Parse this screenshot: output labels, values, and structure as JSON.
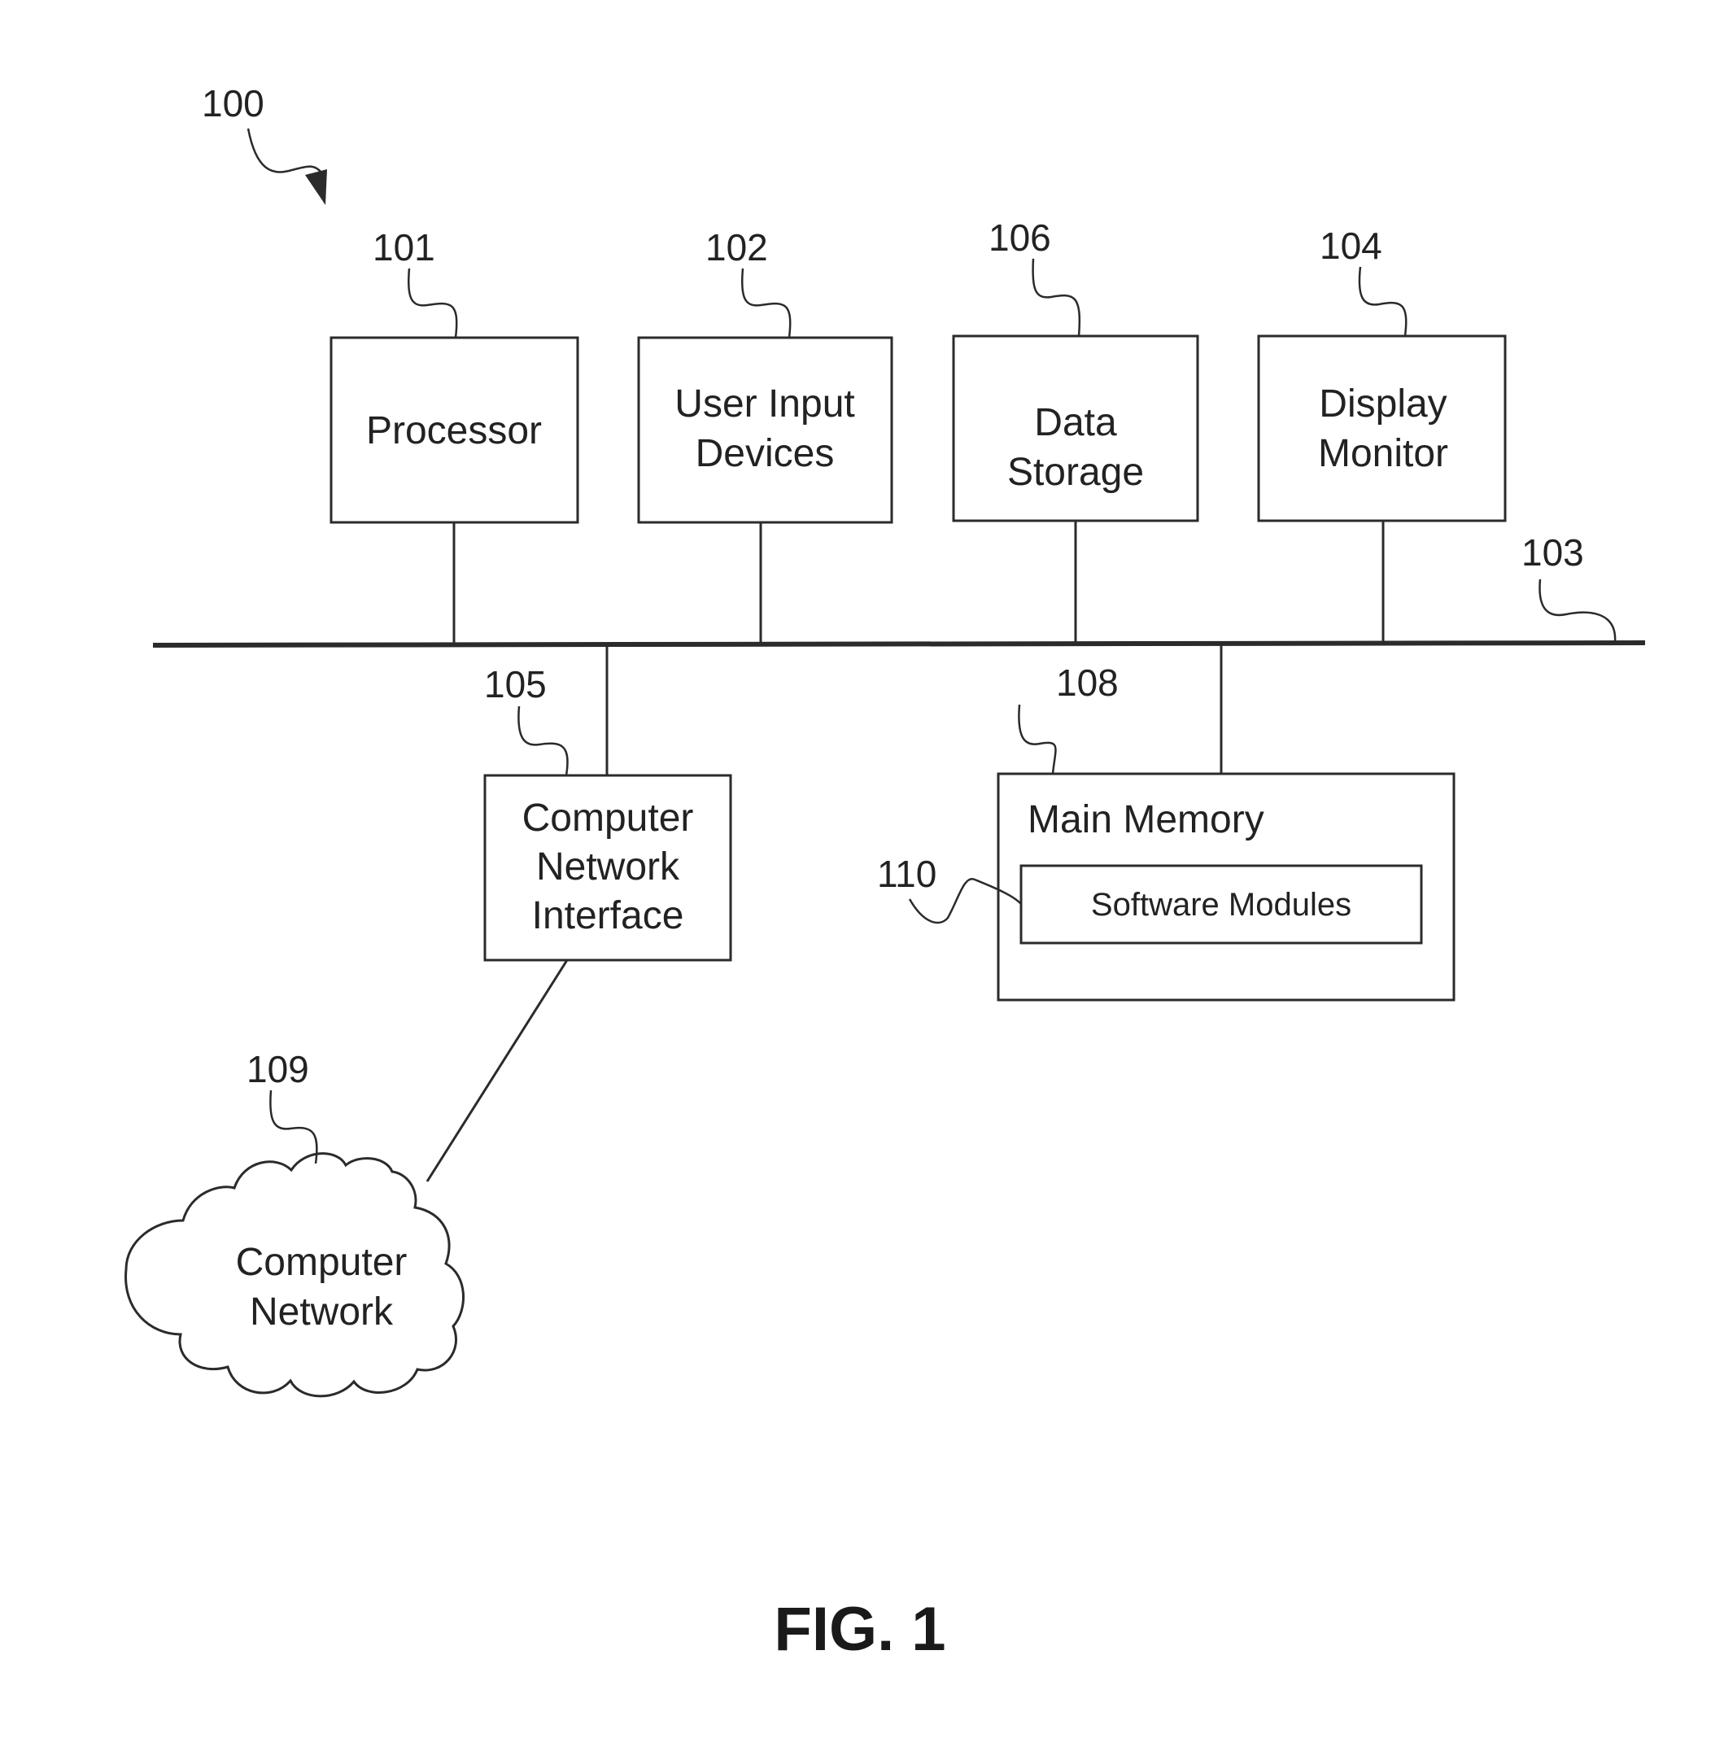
{
  "figure": {
    "caption": "FIG. 1",
    "system_ref": "100"
  },
  "bus": {
    "ref": "103"
  },
  "components": {
    "processor": {
      "ref": "101",
      "lines": [
        "Processor"
      ]
    },
    "user_input": {
      "ref": "102",
      "lines": [
        "User Input",
        "Devices"
      ]
    },
    "data_storage": {
      "ref": "106",
      "lines": [
        "Data",
        "Storage"
      ]
    },
    "display": {
      "ref": "104",
      "lines": [
        "Display",
        "Monitor"
      ]
    },
    "network_interface": {
      "ref": "105",
      "lines": [
        "Computer",
        "Network",
        "Interface"
      ]
    },
    "main_memory": {
      "ref": "108",
      "title": "Main Memory"
    },
    "software_modules": {
      "ref": "110",
      "label": "Software Modules"
    },
    "network": {
      "ref": "109",
      "lines": [
        "Computer",
        "Network"
      ]
    }
  }
}
